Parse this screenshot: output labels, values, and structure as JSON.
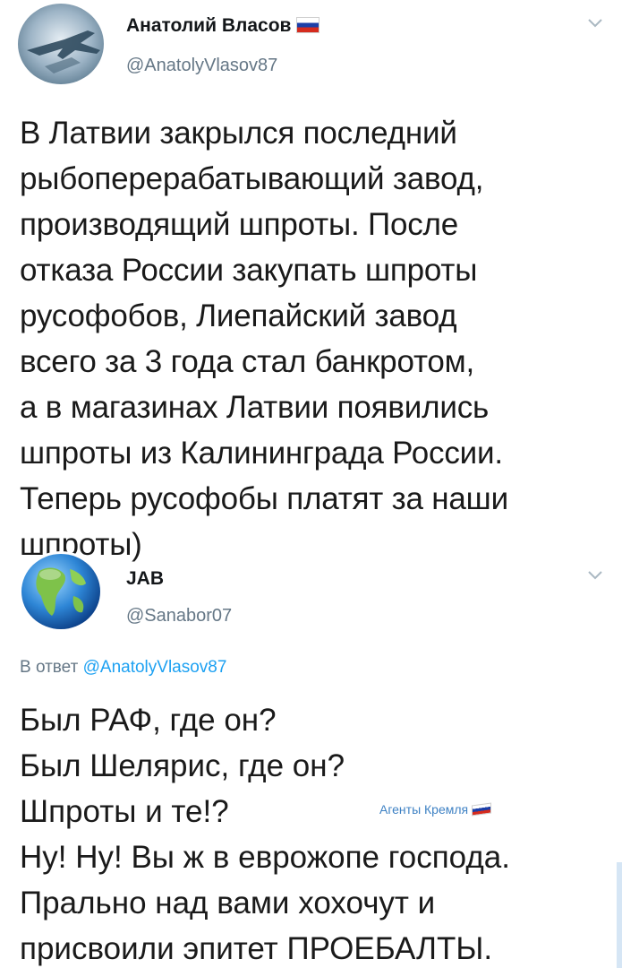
{
  "tweet": {
    "author_name": "Анатолий Власов",
    "author_handle": "@AnatolyVlasov87",
    "text_lines": [
      "В Латвии закрылся последний",
      "рыбоперерабатывающий завод,",
      "производящий шпроты. После",
      "отказа России закупать шпроты",
      "русофобов, Лиепайский завод",
      "всего за 3 года стал банкротом,",
      "а в магазинах Латвии появились",
      "шпроты из Калининграда России.",
      "Теперь русофобы платят за наши",
      "шпроты)"
    ]
  },
  "reply": {
    "author_name": "JAB",
    "author_handle": "@Sanabor07",
    "reply_prefix": "В ответ",
    "reply_mention": "@AnatolyVlasov87",
    "text_lines": [
      "Был РАФ, где он?",
      "Был Шелярис, где он?",
      "Шпроты и те!?",
      "Ну! Ну! Вы ж в еврожопе господа.",
      "Прально над вами хохочут и",
      "присвоили эпитет ПРОЕБАЛТЫ."
    ]
  },
  "watermark": {
    "text": "Агенты Кремля"
  },
  "colors": {
    "handle": "#657786",
    "mention": "#1da1f2",
    "text": "#1a1a1a"
  },
  "icons": {
    "tweet_avatar": "fighter-jet-avatar",
    "reply_avatar": "globe-avatar",
    "menu": "chevron-down-icon",
    "flag": "russian-flag-icon"
  }
}
